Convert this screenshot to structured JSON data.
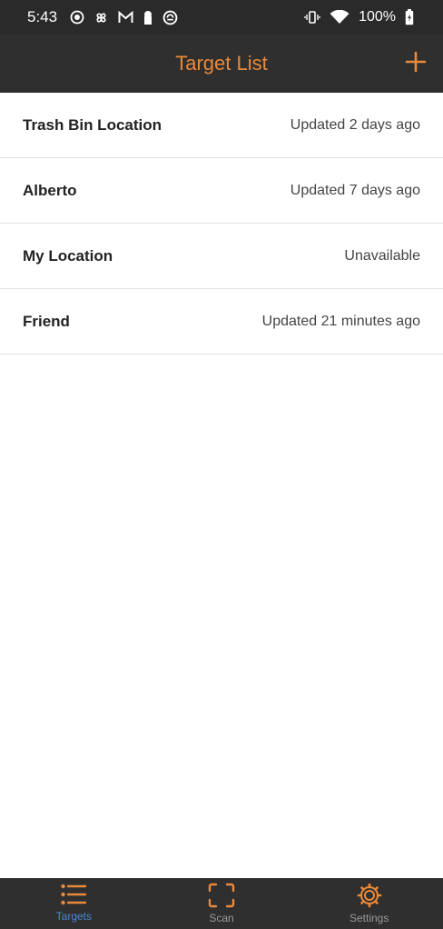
{
  "status_bar": {
    "time": "5:43",
    "battery": "100%",
    "icons_left": [
      "record-icon",
      "pinwheel-icon",
      "gmail-icon",
      "keyhole-icon",
      "sync-icon"
    ],
    "icons_right": [
      "vibrate-icon",
      "wifi-icon",
      "battery-charging-icon"
    ]
  },
  "app_bar": {
    "title": "Target List",
    "add_icon": "plus-icon"
  },
  "targets": [
    {
      "name": "Trash Bin Location",
      "status": "Updated 2 days ago"
    },
    {
      "name": "Alberto",
      "status": "Updated 7 days ago"
    },
    {
      "name": "My Location",
      "status": "Unavailable"
    },
    {
      "name": "Friend",
      "status": "Updated 21 minutes ago"
    }
  ],
  "bottom_nav": {
    "items": [
      {
        "label": "Targets",
        "icon": "list-icon",
        "active": true
      },
      {
        "label": "Scan",
        "icon": "scan-frame-icon",
        "active": false
      },
      {
        "label": "Settings",
        "icon": "gear-icon",
        "active": false
      }
    ]
  },
  "colors": {
    "accent": "#e9893a",
    "bar_background": "#2f2f2f",
    "active_tab": "#4a86d8",
    "inactive_tab": "#9a9a9a"
  }
}
